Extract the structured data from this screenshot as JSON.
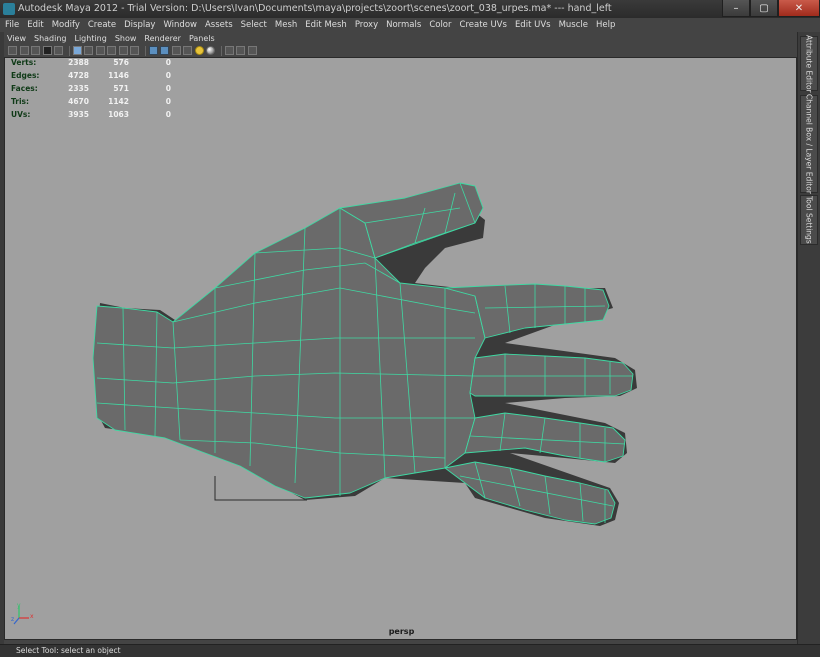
{
  "window": {
    "title": "Autodesk Maya 2012 - Trial Version: D:\\Users\\Ivan\\Documents\\maya\\projects\\zoort\\scenes\\zoort_038_urpes.ma*   ---   hand_left",
    "minimize": "–",
    "maximize": "▢",
    "close": "✕"
  },
  "menu": [
    "File",
    "Edit",
    "Modify",
    "Create",
    "Display",
    "Window",
    "Assets",
    "Select",
    "Mesh",
    "Edit Mesh",
    "Proxy",
    "Normals",
    "Color",
    "Create UVs",
    "Edit UVs",
    "Muscle",
    "Help"
  ],
  "panel_menu": [
    "View",
    "Shading",
    "Lighting",
    "Show",
    "Renderer",
    "Panels"
  ],
  "hud": [
    {
      "label": "Verts:",
      "a": "2388",
      "b": "576",
      "c": "0"
    },
    {
      "label": "Edges:",
      "a": "4728",
      "b": "1146",
      "c": "0"
    },
    {
      "label": "Faces:",
      "a": "2335",
      "b": "571",
      "c": "0"
    },
    {
      "label": "Tris:",
      "a": "4670",
      "b": "1142",
      "c": "0"
    },
    {
      "label": "UVs:",
      "a": "3935",
      "b": "1063",
      "c": "0"
    }
  ],
  "camera_label": "persp",
  "axis_labels": {
    "x": "x",
    "y": "y",
    "z": "z"
  },
  "side_tabs": {
    "attribute_editor": "Attribute Editor",
    "channel_box": "Channel Box / Layer Editor",
    "tool_settings": "Tool Settings"
  },
  "status": "Select Tool: select an object",
  "colors": {
    "wireframe": "#3fd9a3",
    "viewport_bg": "#a0a0a0",
    "mesh_fill": "#6a6a6a"
  }
}
